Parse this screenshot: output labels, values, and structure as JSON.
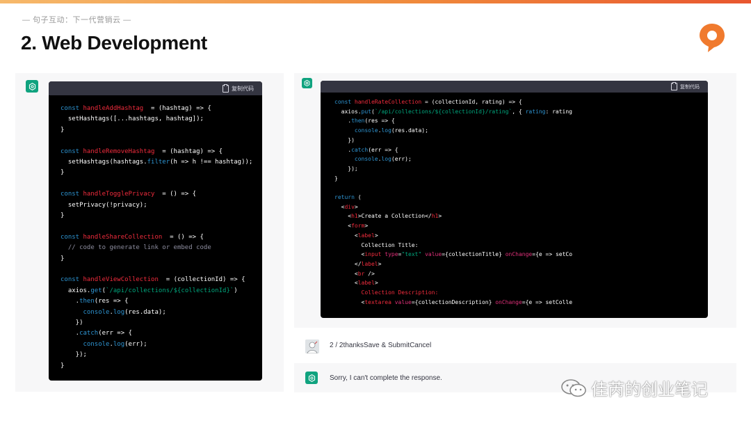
{
  "header": {
    "subtitle": "— 句子互动：下一代营销云 —",
    "title": "2. Web Development"
  },
  "left_code": {
    "copy_label": "复制代码",
    "lines": [
      [
        [
          "c-kw",
          "const "
        ],
        [
          "c-fn",
          "handleAddHashtag"
        ],
        [
          "",
          "  = (hashtag) => {"
        ]
      ],
      [
        [
          "",
          "  setHashtags([...hashtags, hashtag]);"
        ]
      ],
      [
        [
          "",
          "}"
        ]
      ],
      [
        [
          "",
          ""
        ]
      ],
      [
        [
          "c-kw",
          "const "
        ],
        [
          "c-fn",
          "handleRemoveHashtag"
        ],
        [
          "",
          "  = (hashtag) => {"
        ]
      ],
      [
        [
          "",
          "  setHashtags(hashtags."
        ],
        [
          "c-kw",
          "filter"
        ],
        [
          "",
          "(h => h !== hashtag));"
        ]
      ],
      [
        [
          "",
          "}"
        ]
      ],
      [
        [
          "",
          ""
        ]
      ],
      [
        [
          "c-kw",
          "const "
        ],
        [
          "c-fn",
          "handleTogglePrivacy"
        ],
        [
          "",
          "  = () => {"
        ]
      ],
      [
        [
          "",
          "  setPrivacy(!privacy);"
        ]
      ],
      [
        [
          "",
          "}"
        ]
      ],
      [
        [
          "",
          ""
        ]
      ],
      [
        [
          "c-kw",
          "const "
        ],
        [
          "c-fn",
          "handleShareCollection"
        ],
        [
          "",
          "  = () => {"
        ]
      ],
      [
        [
          "c-cmt",
          "  // code to generate link or embed code"
        ]
      ],
      [
        [
          "",
          "}"
        ]
      ],
      [
        [
          "",
          ""
        ]
      ],
      [
        [
          "c-kw",
          "const "
        ],
        [
          "c-fn",
          "handleViewCollection"
        ],
        [
          "",
          "  = (collectionId) => {"
        ]
      ],
      [
        [
          "",
          "  axios."
        ],
        [
          "c-kw",
          "get"
        ],
        [
          "",
          "("
        ],
        [
          "c-str",
          "`/api/collections/${collectionId}`"
        ],
        [
          "",
          ")"
        ]
      ],
      [
        [
          "",
          "    ."
        ],
        [
          "c-kw",
          "then"
        ],
        [
          "",
          "(res => {"
        ]
      ],
      [
        [
          "",
          "      "
        ],
        [
          "c-kw",
          "console"
        ],
        [
          "",
          "."
        ],
        [
          "c-kw",
          "log"
        ],
        [
          "",
          "(res.data);"
        ]
      ],
      [
        [
          "",
          "    })"
        ]
      ],
      [
        [
          "",
          "    ."
        ],
        [
          "c-kw",
          "catch"
        ],
        [
          "",
          "(err => {"
        ]
      ],
      [
        [
          "",
          "      "
        ],
        [
          "c-kw",
          "console"
        ],
        [
          "",
          "."
        ],
        [
          "c-kw",
          "log"
        ],
        [
          "",
          "(err);"
        ]
      ],
      [
        [
          "",
          "    });"
        ]
      ],
      [
        [
          "",
          "}"
        ]
      ]
    ]
  },
  "right_code": {
    "copy_label": "复制代码",
    "lines": [
      [
        [
          "c-kw",
          "const "
        ],
        [
          "c-fn",
          "handleRateCollection"
        ],
        [
          "",
          " = (collectionId, rating) => {"
        ]
      ],
      [
        [
          "",
          "  axios."
        ],
        [
          "c-kw",
          "put"
        ],
        [
          "",
          "("
        ],
        [
          "c-str",
          "`/api/collections/${collectionId}/rating`"
        ],
        [
          "",
          ", { "
        ],
        [
          "c-kw",
          "rating"
        ],
        [
          "",
          ": rating"
        ]
      ],
      [
        [
          "",
          "    ."
        ],
        [
          "c-kw",
          "then"
        ],
        [
          "",
          "(res => {"
        ]
      ],
      [
        [
          "",
          "      "
        ],
        [
          "c-kw",
          "console"
        ],
        [
          "",
          "."
        ],
        [
          "c-kw",
          "log"
        ],
        [
          "",
          "(res.data);"
        ]
      ],
      [
        [
          "",
          "    })"
        ]
      ],
      [
        [
          "",
          "    ."
        ],
        [
          "c-kw",
          "catch"
        ],
        [
          "",
          "(err => {"
        ]
      ],
      [
        [
          "",
          "      "
        ],
        [
          "c-kw",
          "console"
        ],
        [
          "",
          "."
        ],
        [
          "c-kw",
          "log"
        ],
        [
          "",
          "(err);"
        ]
      ],
      [
        [
          "",
          "    });"
        ]
      ],
      [
        [
          "",
          "}"
        ]
      ],
      [
        [
          "",
          ""
        ]
      ],
      [
        [
          "c-kw",
          "return"
        ],
        [
          "",
          " ("
        ]
      ],
      [
        [
          "",
          "  <"
        ],
        [
          "c-tag",
          "div"
        ],
        [
          "",
          ">"
        ]
      ],
      [
        [
          "",
          "    <"
        ],
        [
          "c-tag",
          "h1"
        ],
        [
          "",
          ">Create a Collection</"
        ],
        [
          "c-tag",
          "h1"
        ],
        [
          "",
          ">"
        ]
      ],
      [
        [
          "",
          "    <"
        ],
        [
          "c-tag",
          "form"
        ],
        [
          "",
          ">"
        ]
      ],
      [
        [
          "",
          "      <"
        ],
        [
          "c-tag",
          "label"
        ],
        [
          "",
          ">"
        ]
      ],
      [
        [
          "",
          "        Collection Title:"
        ]
      ],
      [
        [
          "",
          "        <"
        ],
        [
          "c-tag",
          "input"
        ],
        [
          "",
          " "
        ],
        [
          "c-attr",
          "type"
        ],
        [
          "",
          "="
        ],
        [
          "c-str",
          "\"text\""
        ],
        [
          "",
          " "
        ],
        [
          "c-attr",
          "value"
        ],
        [
          "",
          "={collectionTitle} "
        ],
        [
          "c-attr",
          "onChange"
        ],
        [
          "",
          "={e => setCo"
        ]
      ],
      [
        [
          "",
          "      </"
        ],
        [
          "c-tag",
          "label"
        ],
        [
          "",
          ">"
        ]
      ],
      [
        [
          "",
          "      <"
        ],
        [
          "c-tag",
          "br"
        ],
        [
          "",
          " />"
        ]
      ],
      [
        [
          "",
          "      <"
        ],
        [
          "c-tag",
          "label"
        ],
        [
          "",
          ">"
        ]
      ],
      [
        [
          "c-fn",
          "        Collection Description:"
        ]
      ],
      [
        [
          "",
          "        <"
        ],
        [
          "c-tag",
          "textarea"
        ],
        [
          "",
          " "
        ],
        [
          "c-attr",
          "value"
        ],
        [
          "",
          "={collectionDescription} "
        ],
        [
          "c-attr",
          "onChange"
        ],
        [
          "",
          "={e => setColle"
        ]
      ]
    ]
  },
  "messages": {
    "user_text": "2 / 2thanksSave & SubmitCancel",
    "assistant_text": "Sorry, I can't complete the response."
  },
  "watermark": {
    "text": "佳芮的创业笔记"
  }
}
